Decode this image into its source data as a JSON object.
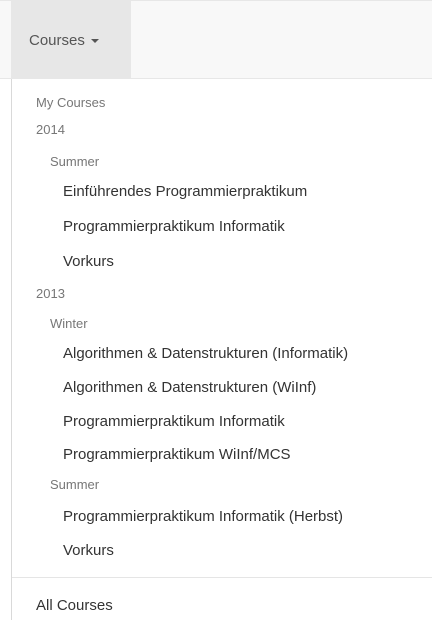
{
  "nav": {
    "toggle_label": "Courses"
  },
  "menu": {
    "my_courses_header": "My Courses",
    "years": [
      {
        "year": "2014",
        "terms": [
          {
            "term": "Summer",
            "courses": [
              "Einführendes Programmierpraktikum",
              "Programmierpraktikum Informatik",
              "Vorkurs"
            ]
          }
        ]
      },
      {
        "year": "2013",
        "terms": [
          {
            "term": "Winter",
            "courses": [
              "Algorithmen & Datenstrukturen (Informatik)",
              "Algorithmen & Datenstrukturen (WiInf)",
              "Programmierpraktikum Informatik",
              "Programmierpraktikum WiInf/MCS"
            ]
          },
          {
            "term": "Summer",
            "courses": [
              "Programmierpraktikum Informatik (Herbst)",
              "Vorkurs"
            ]
          }
        ]
      }
    ],
    "all_courses_label": "All Courses"
  }
}
